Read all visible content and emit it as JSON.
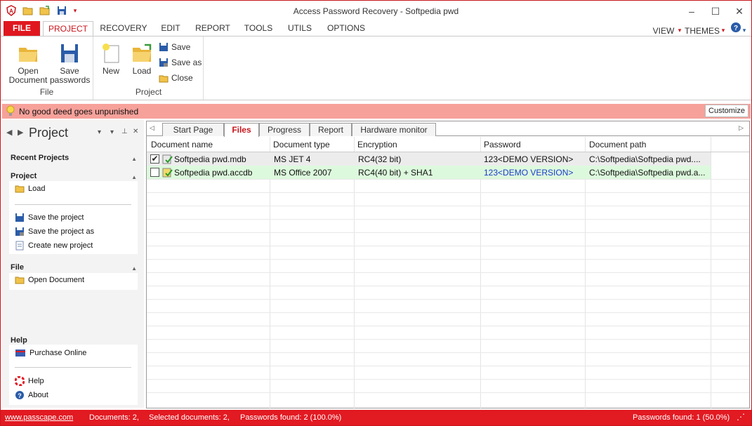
{
  "window": {
    "title": "Access Password Recovery - Softpedia pwd"
  },
  "menu_tabs": [
    "FILE",
    "PROJECT",
    "RECOVERY",
    "EDIT",
    "REPORT",
    "TOOLS",
    "UTILS",
    "OPTIONS"
  ],
  "menu_right": {
    "view": "VIEW",
    "themes": "THEMES"
  },
  "ribbon": {
    "file_group": {
      "label": "File",
      "open_doc": "Open Document",
      "save_passwords": "Save passwords"
    },
    "project_group": {
      "label": "Project",
      "new": "New",
      "load": "Load",
      "save": "Save",
      "save_as": "Save as",
      "close": "Close"
    }
  },
  "infobar": {
    "message": "No good deed goes unpunished",
    "customize": "Customize"
  },
  "left_pane": {
    "title": "Project",
    "recent_projects": "Recent Projects",
    "project_section": "Project",
    "load": "Load",
    "save_project": "Save the project",
    "save_project_as": "Save the project as",
    "create_project": "Create new project",
    "file_section": "File",
    "open_document": "Open Document",
    "help_section": "Help",
    "purchase": "Purchase Online",
    "help": "Help",
    "about": "About"
  },
  "doc_tabs": [
    "Start Page",
    "Files",
    "Progress",
    "Report",
    "Hardware monitor"
  ],
  "grid": {
    "columns": [
      "Document name",
      "Document type",
      "Encryption",
      "Password",
      "Document path"
    ],
    "rows": [
      {
        "checked": "✔",
        "name": "Softpedia pwd.mdb",
        "type": "MS JET 4",
        "encryption": "RC4(32 bit)",
        "password": "123<DEMO VERSION>",
        "path": "C:\\Softpedia\\Softpedia pwd...."
      },
      {
        "checked": "",
        "name": "Softpedia pwd.accdb",
        "type": "MS Office 2007",
        "encryption": "RC4(40 bit) + SHA1",
        "password": "123<DEMO VERSION>",
        "path": "C:\\Softpedia\\Softpedia pwd.a..."
      }
    ]
  },
  "status": {
    "website": "www.passcape.com",
    "documents": "Documents: 2,",
    "selected": "Selected documents: 2,",
    "found": "Passwords found: 2 (100.0%)",
    "found_right": "Passwords found: 1 (50.0%)"
  },
  "colors": {
    "accent": "#e21a22",
    "infobar": "#f6a19a",
    "selected_row": "#ececec",
    "green_row": "#ddf9dd",
    "link_blue": "#1a3ccc"
  }
}
